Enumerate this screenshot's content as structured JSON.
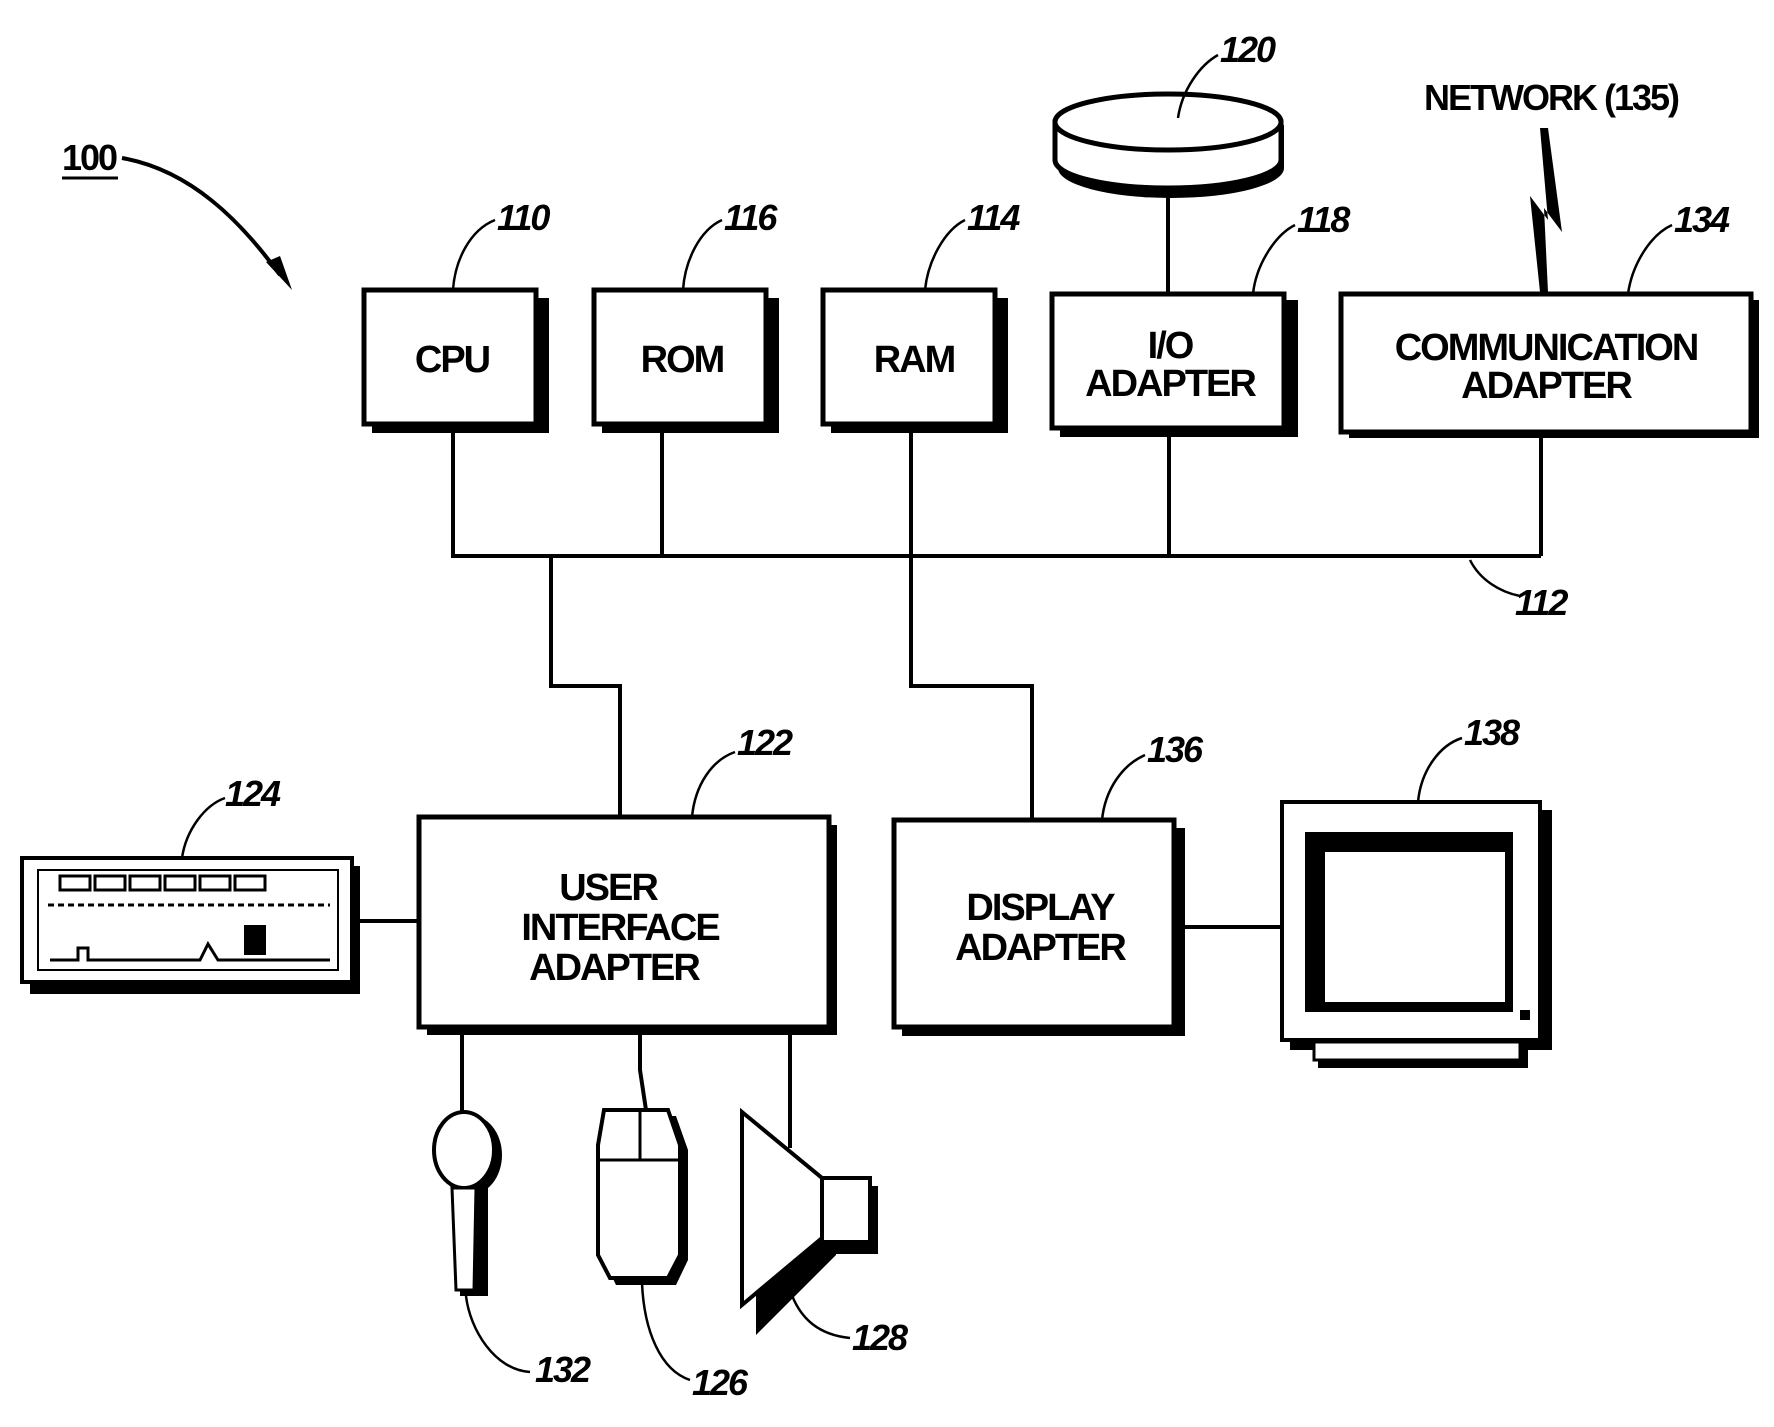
{
  "figure": {
    "system_ref": "100",
    "blocks": {
      "cpu": {
        "label": "CPU",
        "ref": "110"
      },
      "rom": {
        "label": "ROM",
        "ref": "116"
      },
      "ram": {
        "label": "RAM",
        "ref": "114"
      },
      "io_adapter": {
        "line1": "I/O",
        "line2": "ADAPTER",
        "ref": "118"
      },
      "comm_adapter": {
        "line1": "COMMUNICATION",
        "line2": "ADAPTER",
        "ref": "134"
      },
      "ui_adapter": {
        "line1": "USER",
        "line2": "INTERFACE",
        "line3": "ADAPTER",
        "ref": "122"
      },
      "display_adapter": {
        "line1": "DISPLAY",
        "line2": "ADAPTER",
        "ref": "136"
      }
    },
    "bus_ref": "112",
    "disk_ref": "120",
    "network_label": "NETWORK (135)",
    "keyboard_ref": "124",
    "monitor_ref": "138",
    "microphone_ref": "132",
    "mouse_ref": "126",
    "speaker_ref": "128"
  }
}
